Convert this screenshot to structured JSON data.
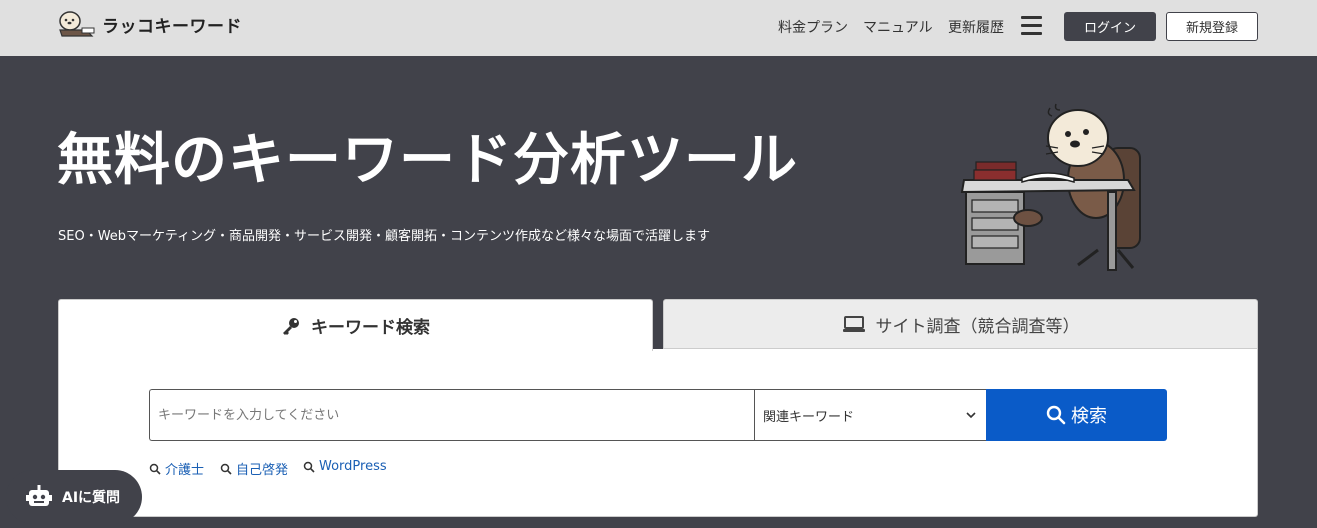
{
  "header": {
    "logo_text": "ラッコキーワード",
    "nav": [
      "料金プラン",
      "マニュアル",
      "更新履歴"
    ],
    "login_label": "ログイン",
    "signup_label": "新規登録"
  },
  "hero": {
    "title": "無料のキーワード分析ツール",
    "subtitle": "SEO・Webマーケティング・商品開発・サービス開発・顧客開拓・コンテンツ作成など様々な場面で活躍します"
  },
  "tabs": [
    {
      "label": "キーワード検索",
      "icon": "key-icon",
      "active": true
    },
    {
      "label": "サイト調査（競合調査等）",
      "icon": "laptop-icon",
      "active": false
    }
  ],
  "search": {
    "placeholder": "キーワードを入力してください",
    "value": "",
    "select_value": "関連キーワード",
    "button_label": "検索"
  },
  "suggestions": [
    "介護士",
    "自己啓発",
    "WordPress"
  ],
  "ai_button": {
    "label": "AIに質問"
  },
  "colors": {
    "header_bg": "#e0e0e0",
    "hero_bg": "#41424a",
    "accent": "#0a5bc8",
    "link": "#1a5fb4"
  }
}
